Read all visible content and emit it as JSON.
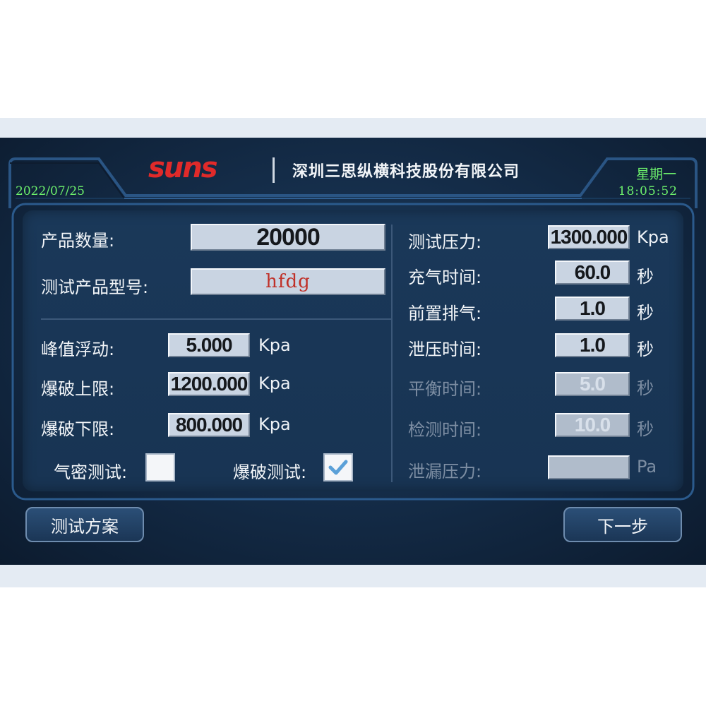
{
  "header": {
    "logo_text": "suns",
    "company": "深圳三思纵横科技股份有限公司",
    "date": "2022/07/25",
    "weekday": "星期一",
    "time": "18:05:52"
  },
  "left": {
    "product_qty": {
      "label": "产品数量:",
      "value": "20000"
    },
    "product_model": {
      "label": "测试产品型号:",
      "value": "hfdg"
    },
    "peak_float": {
      "label": "峰值浮动:",
      "value": "5.000",
      "unit": "Kpa"
    },
    "burst_upper": {
      "label": "爆破上限:",
      "value": "1200.000",
      "unit": "Kpa"
    },
    "burst_lower": {
      "label": "爆破下限:",
      "value": "800.000",
      "unit": "Kpa"
    },
    "airtight_test": {
      "label": "气密测试:",
      "checked": false
    },
    "burst_test": {
      "label": "爆破测试:",
      "checked": true
    }
  },
  "right": {
    "test_pressure": {
      "label": "测试压力:",
      "value": "1300.000",
      "unit": "Kpa"
    },
    "fill_time": {
      "label": "充气时间:",
      "value": "60.0",
      "unit": "秒"
    },
    "pre_exhaust": {
      "label": "前置排气:",
      "value": "1.0",
      "unit": "秒"
    },
    "release_time": {
      "label": "泄压时间:",
      "value": "1.0",
      "unit": "秒"
    },
    "balance_time": {
      "label": "平衡时间:",
      "value": "5.0",
      "unit": "秒"
    },
    "detect_time": {
      "label": "检测时间:",
      "value": "10.0",
      "unit": "秒"
    },
    "leak_pressure": {
      "label": "泄漏压力:",
      "value": "",
      "unit": "Pa"
    }
  },
  "buttons": {
    "test_plan": "测试方案",
    "next_step": "下一步"
  },
  "colors": {
    "accent_green": "#6cf06c",
    "logo_red": "#e02a2a",
    "model_text_red": "#c03028"
  }
}
